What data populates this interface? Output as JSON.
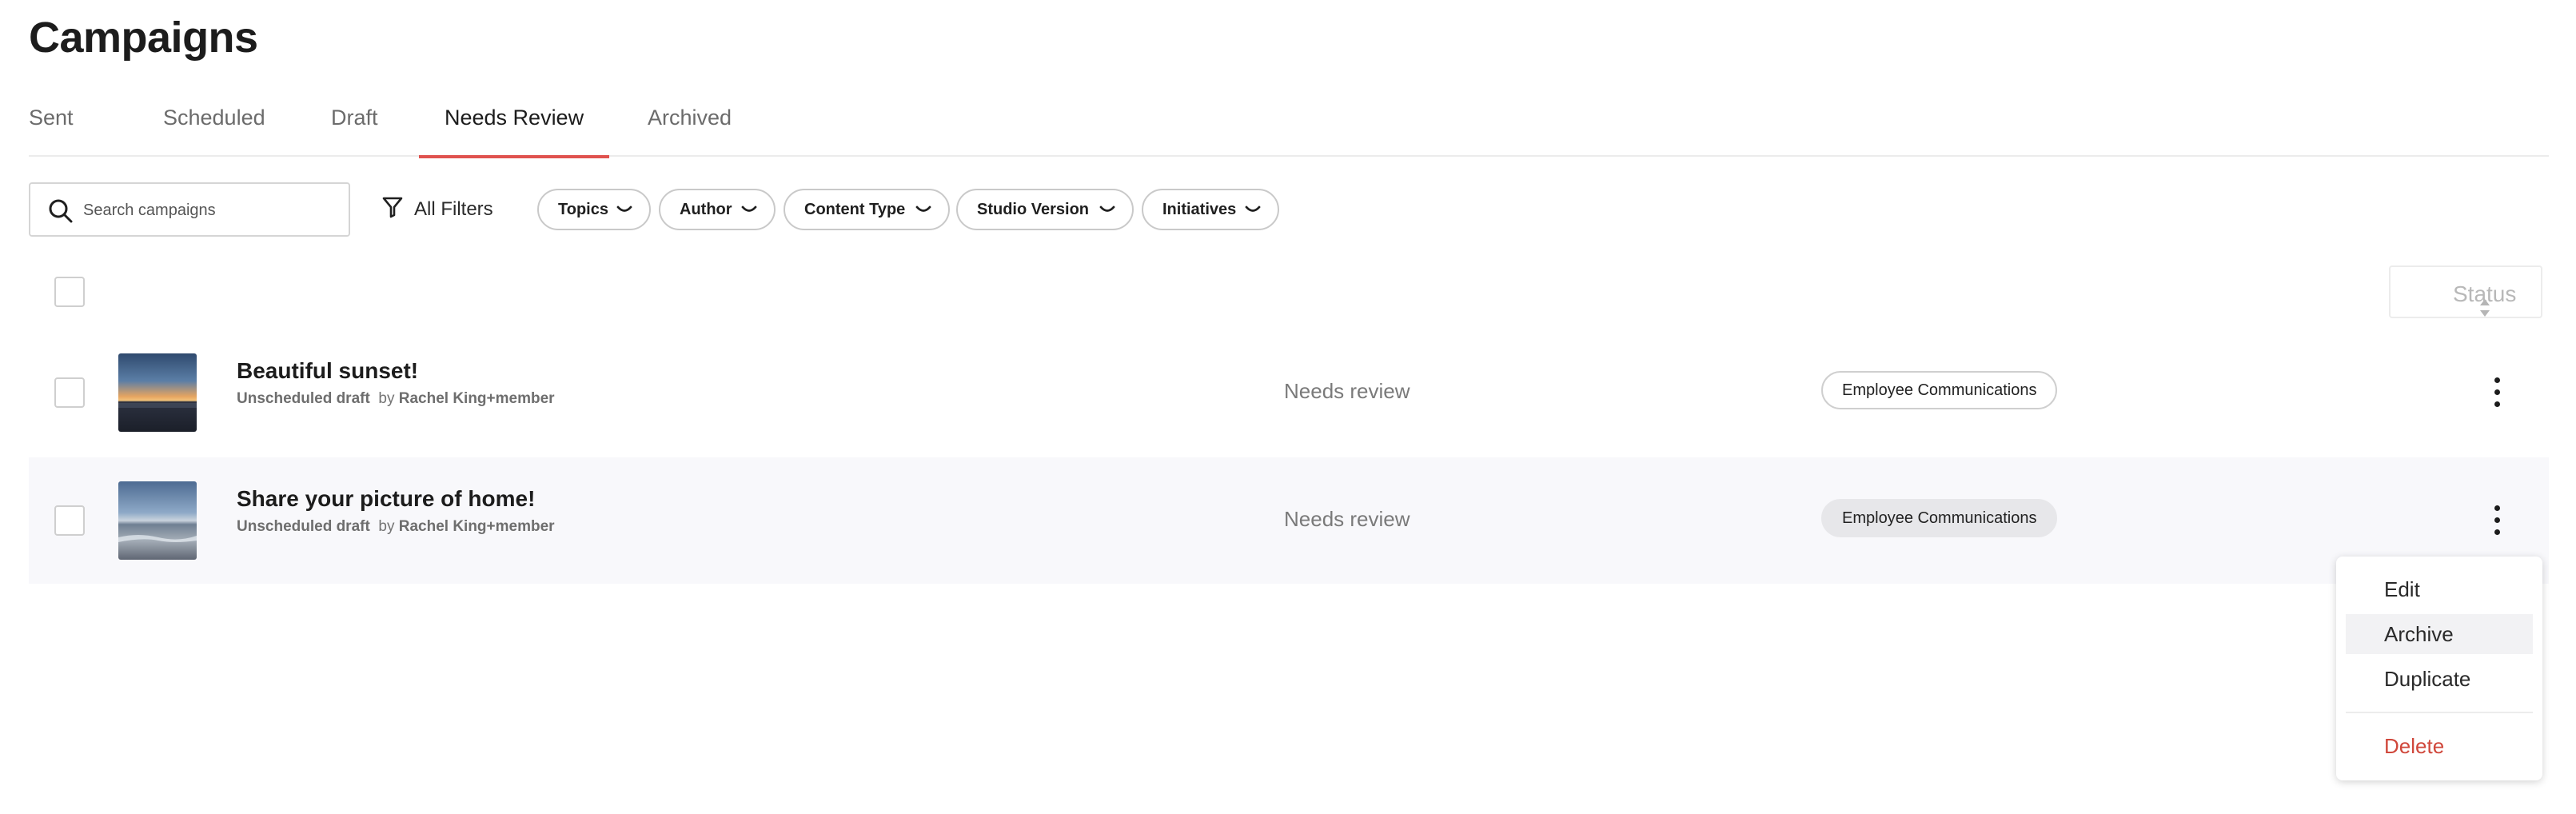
{
  "page": {
    "title": "Campaigns"
  },
  "tabs": [
    {
      "label": "Sent"
    },
    {
      "label": "Scheduled"
    },
    {
      "label": "Draft"
    },
    {
      "label": "Needs Review",
      "active": true
    },
    {
      "label": "Archived"
    }
  ],
  "toolbar": {
    "search_placeholder": "Search campaigns",
    "all_filters_label": "All Filters",
    "filters": [
      {
        "label": "Topics"
      },
      {
        "label": "Author"
      },
      {
        "label": "Content Type"
      },
      {
        "label": "Studio Version"
      },
      {
        "label": "Initiatives"
      }
    ]
  },
  "table": {
    "status_column_label": "Status",
    "rows": [
      {
        "title": "Beautiful sunset!",
        "state": "Unscheduled draft",
        "by": "by",
        "author": "Rachel King+member",
        "status": "Needs review",
        "tag": "Employee Communications"
      },
      {
        "title": "Share your picture of home!",
        "state": "Unscheduled draft",
        "by": "by",
        "author": "Rachel King+member",
        "status": "Needs review",
        "tag": "Employee Communications"
      }
    ]
  },
  "row_menu": {
    "items": [
      {
        "label": "Edit"
      },
      {
        "label": "Archive",
        "hovered": true
      },
      {
        "label": "Duplicate"
      },
      {
        "label": "Delete",
        "danger": true
      }
    ]
  },
  "colors": {
    "accent": "#e0524e",
    "danger": "#d0473b",
    "row_highlight": "#f8f8fb",
    "tag_filled": "#e7e7ea"
  },
  "icons": {
    "search": "search-icon",
    "filter": "filter-icon",
    "chevron": "chevron-down-icon",
    "sort": "sort-icon",
    "more": "kebab-menu-icon"
  }
}
